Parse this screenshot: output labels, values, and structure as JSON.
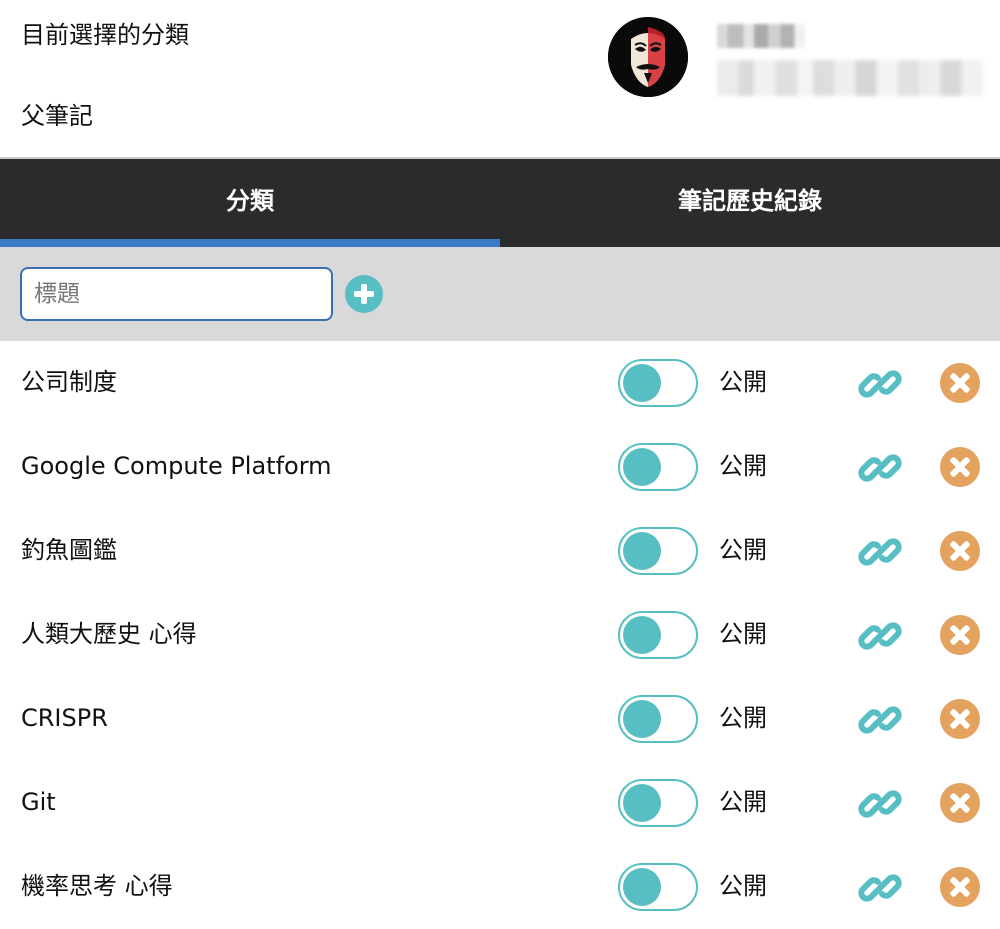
{
  "header": {
    "current_category_label": "目前選擇的分類",
    "parent_note_label": "父筆記"
  },
  "tabs": [
    {
      "label": "分類",
      "active": true
    },
    {
      "label": "筆記歷史紀錄",
      "active": false
    }
  ],
  "add_form": {
    "placeholder": "標題",
    "value": ""
  },
  "categories": [
    {
      "title": "公司制度",
      "toggle_on": true,
      "status": "公開"
    },
    {
      "title": "Google Compute Platform",
      "toggle_on": true,
      "status": "公開"
    },
    {
      "title": "釣魚圖鑑",
      "toggle_on": true,
      "status": "公開"
    },
    {
      "title": "人類大歷史 心得",
      "toggle_on": true,
      "status": "公開"
    },
    {
      "title": "CRISPR",
      "toggle_on": true,
      "status": "公開"
    },
    {
      "title": "Git",
      "toggle_on": true,
      "status": "公開"
    },
    {
      "title": "機率思考 心得",
      "toggle_on": true,
      "status": "公開"
    }
  ],
  "icons": {
    "add": "plus-circle-icon",
    "link": "link-icon",
    "delete": "close-circle-icon"
  },
  "colors": {
    "tab_bar": "#2b2b2b",
    "tab_indicator": "#3a7cc9",
    "accent": "#57bfc3",
    "delete": "#e3a25e",
    "add_bar_bg": "#d9d9d9"
  }
}
